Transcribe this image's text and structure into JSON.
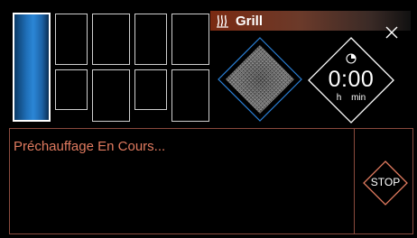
{
  "header": {
    "mode_label": "Grill",
    "mode_icon": "grill-icon",
    "close_icon": "close-icon"
  },
  "cavity": {
    "cells": [
      {
        "name": "cavity-cell-main",
        "active": true
      },
      {
        "name": "cavity-cell-top-1",
        "active": false
      },
      {
        "name": "cavity-cell-top-2",
        "active": false
      },
      {
        "name": "cavity-cell-top-3",
        "active": false
      },
      {
        "name": "cavity-cell-top-4",
        "active": false
      },
      {
        "name": "cavity-cell-bottom-1",
        "active": false
      },
      {
        "name": "cavity-cell-bottom-2",
        "active": false
      },
      {
        "name": "cavity-cell-bottom-3",
        "active": false
      },
      {
        "name": "cavity-cell-bottom-4",
        "active": false
      }
    ]
  },
  "timer": {
    "value": "0:00",
    "units": "h min",
    "icon": "clock-icon"
  },
  "status": {
    "message": "Préchauffage En Cours..."
  },
  "controls": {
    "stop_label": "STOP"
  },
  "colors": {
    "accent": "#e07a5f",
    "active_blue": "#2b86d6",
    "heater_blue": "#2a7fd6",
    "panel_border": "#8a4a3e"
  }
}
